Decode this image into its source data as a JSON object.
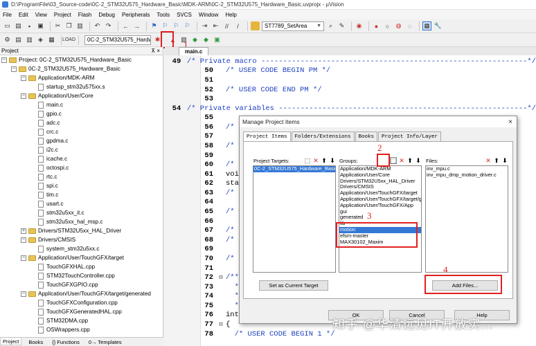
{
  "window": {
    "title": "D:\\ProgramFile\\03_Source-code\\0C-2_STM32U575_Hardware_Basic\\MDK-ARM\\0C-2_STM32U575_Hardware_Basic.uvprojx - µVision"
  },
  "menu": [
    "File",
    "Edit",
    "View",
    "Project",
    "Flash",
    "Debug",
    "Peripherals",
    "Tools",
    "SVCS",
    "Window",
    "Help"
  ],
  "toolbar1": {
    "function_combo": "ST7789_SetArea"
  },
  "toolbar2": {
    "target_combo": "0C-2_STM32U575_Hardw"
  },
  "annotations": {
    "a1": "1",
    "a2": "2",
    "a3": "3",
    "a4": "4"
  },
  "project_panel": {
    "title": "Project",
    "pin": "⊼ ×",
    "tree": [
      {
        "label": "Project: 0C-2_STM32U575_Hardware_Basic",
        "indent": 0,
        "kind": "root",
        "exp": "−"
      },
      {
        "label": "0C-2_STM32U575_Hardware_Basic",
        "indent": 1,
        "kind": "folder",
        "exp": "−"
      },
      {
        "label": "Application/MDK-ARM",
        "indent": 2,
        "kind": "folder",
        "exp": "−"
      },
      {
        "label": "startup_stm32u575xx.s",
        "indent": 3,
        "kind": "file"
      },
      {
        "label": "Application/User/Core",
        "indent": 2,
        "kind": "folder",
        "exp": "−"
      },
      {
        "label": "main.c",
        "indent": 3,
        "kind": "file"
      },
      {
        "label": "gpio.c",
        "indent": 3,
        "kind": "file"
      },
      {
        "label": "adc.c",
        "indent": 3,
        "kind": "file"
      },
      {
        "label": "crc.c",
        "indent": 3,
        "kind": "file"
      },
      {
        "label": "gpdma.c",
        "indent": 3,
        "kind": "file"
      },
      {
        "label": "i2c.c",
        "indent": 3,
        "kind": "file"
      },
      {
        "label": "icache.c",
        "indent": 3,
        "kind": "file"
      },
      {
        "label": "octospi.c",
        "indent": 3,
        "kind": "file"
      },
      {
        "label": "rtc.c",
        "indent": 3,
        "kind": "file"
      },
      {
        "label": "spi.c",
        "indent": 3,
        "kind": "file"
      },
      {
        "label": "tim.c",
        "indent": 3,
        "kind": "file"
      },
      {
        "label": "usart.c",
        "indent": 3,
        "kind": "file"
      },
      {
        "label": "stm32u5xx_it.c",
        "indent": 3,
        "kind": "file"
      },
      {
        "label": "stm32u5xx_hal_msp.c",
        "indent": 3,
        "kind": "file"
      },
      {
        "label": "Drivers/STM32U5xx_HAL_Driver",
        "indent": 2,
        "kind": "folder",
        "exp": "+"
      },
      {
        "label": "Drivers/CMSIS",
        "indent": 2,
        "kind": "folder",
        "exp": "−"
      },
      {
        "label": "system_stm32u5xx.c",
        "indent": 3,
        "kind": "file"
      },
      {
        "label": "Application/User/TouchGFX/target",
        "indent": 2,
        "kind": "folder",
        "exp": "−"
      },
      {
        "label": "TouchGFXHAL.cpp",
        "indent": 3,
        "kind": "file"
      },
      {
        "label": "STM32TouchController.cpp",
        "indent": 3,
        "kind": "file"
      },
      {
        "label": "TouchGFXGPIO.cpp",
        "indent": 3,
        "kind": "file"
      },
      {
        "label": "Application/User/TouchGFX/target/generated",
        "indent": 2,
        "kind": "folder",
        "exp": "−"
      },
      {
        "label": "TouchGFXConfiguration.cpp",
        "indent": 3,
        "kind": "file"
      },
      {
        "label": "TouchGFXGeneratedHAL.cpp",
        "indent": 3,
        "kind": "file"
      },
      {
        "label": "STM32DMA.cpp",
        "indent": 3,
        "kind": "file"
      },
      {
        "label": "OSWrappers.cpp",
        "indent": 3,
        "kind": "file"
      }
    ],
    "bottom_tabs": [
      "Project",
      "Books",
      "{} Functions",
      "0→ Templates"
    ]
  },
  "editor": {
    "tab": "main.c",
    "lines": [
      {
        "n": "49",
        "fm": "",
        "t": "/* Private macro -------------------------------------------------------------*/",
        "c": 1
      },
      {
        "n": "50",
        "fm": "",
        "t": "/* USER CODE BEGIN PM */",
        "c": 1
      },
      {
        "n": "51",
        "fm": "",
        "t": "",
        "c": 1
      },
      {
        "n": "52",
        "fm": "",
        "t": "/* USER CODE END PM */",
        "c": 1
      },
      {
        "n": "53",
        "fm": "",
        "t": "",
        "c": 1
      },
      {
        "n": "54",
        "fm": "",
        "t": "/* Private variables ---------------------------------------------------------*/",
        "c": 1
      },
      {
        "n": "55",
        "fm": "",
        "t": "",
        "c": 1
      },
      {
        "n": "56",
        "fm": "",
        "t": "/* USER C",
        "c": 1
      },
      {
        "n": "57",
        "fm": "",
        "t": "",
        "c": 1
      },
      {
        "n": "58",
        "fm": "",
        "t": "/* USER C",
        "c": 1
      },
      {
        "n": "59",
        "fm": "",
        "t": "",
        "c": 1
      },
      {
        "n": "60",
        "fm": "",
        "t": "/* Privat",
        "c": 1
      },
      {
        "n": "61",
        "fm": "",
        "t": "void Syst",
        "c": 0
      },
      {
        "n": "62",
        "fm": "",
        "t": "static vo",
        "c": 0
      },
      {
        "n": "63",
        "fm": "",
        "t": "/* USER C",
        "c": 1
      },
      {
        "n": "64",
        "fm": "",
        "t": "",
        "c": 1
      },
      {
        "n": "65",
        "fm": "",
        "t": "/* USER C",
        "c": 1
      },
      {
        "n": "66",
        "fm": "",
        "t": "",
        "c": 1
      },
      {
        "n": "67",
        "fm": "",
        "t": "/* Privat",
        "c": 1
      },
      {
        "n": "68",
        "fm": "",
        "t": "/* USER C",
        "c": 1
      },
      {
        "n": "69",
        "fm": "",
        "t": "",
        "c": 1
      },
      {
        "n": "70",
        "fm": "",
        "t": "/* USER C",
        "c": 1
      },
      {
        "n": "71",
        "fm": "",
        "t": "",
        "c": 1
      },
      {
        "n": "72",
        "fm": "⊟",
        "t": "/**",
        "c": 1
      },
      {
        "n": "73",
        "fm": "",
        "t": "  * @brie",
        "c": 1
      },
      {
        "n": "74",
        "fm": "",
        "t": "  * @retv",
        "c": 1
      },
      {
        "n": "75",
        "fm": "",
        "t": "  */",
        "c": 1
      },
      {
        "n": "76",
        "fm": "",
        "t": "int main",
        "c": 0
      },
      {
        "n": "77",
        "fm": "⊟",
        "t": "{",
        "c": 0
      },
      {
        "n": "78",
        "fm": "",
        "t": "  /* USER CODE BEGIN 1 */",
        "c": 1
      }
    ]
  },
  "dialog": {
    "title": "Manage Project Items",
    "close": "×",
    "tabs": [
      "Project Items",
      "Folders/Extensions",
      "Books",
      "Project Info/Layer"
    ],
    "targets": {
      "label": "Project Targets:",
      "items": [
        "0C-2_STM32U575_Hardware_Basic"
      ]
    },
    "groups": {
      "label": "Groups:",
      "items": [
        "Application/MDK-ARM",
        "Application/User/Core",
        "Drivers/STM32U5xx_HAL_Driver",
        "Drivers/CMSIS",
        "Application/User/TouchGFX/target",
        "Application/User/TouchGFX/target/ge",
        "Application/User/TouchGFX/App",
        "gui",
        "generated",
        "lib",
        "motion",
        "efsm-master",
        "MAX30102_Maxim"
      ],
      "selected": "motion"
    },
    "files": {
      "label": "Files:",
      "items": [
        "inv_mpu.c",
        "inv_mpu_dmp_motion_driver.c"
      ]
    },
    "set_current": "Set as Current Target",
    "add_files": "Add Files...",
    "ok": "OK",
    "cancel": "Cancel",
    "help": "Help"
  },
  "watermark": "知乎 @华清远见IT开放实..."
}
